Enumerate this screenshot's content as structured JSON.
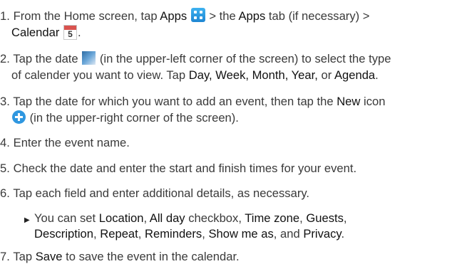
{
  "steps": [
    {
      "num": "1.",
      "a": "From the Home screen, tap ",
      "b": "Apps",
      "c": " > the ",
      "d": "Apps",
      "e": " tab (if necessary) >",
      "f": "Calendar",
      "g": ".",
      "cal_day": "5",
      "icon_apps": "apps-icon",
      "icon_calendar": "calendar-icon"
    },
    {
      "num": "2.",
      "a": "Tap the date ",
      "b": " (in the upper-left corner of the screen) to select the type",
      "c": "of calender you want to view. Tap ",
      "d": "Day, Week, Month, Year,",
      "e": " or ",
      "f": "Agenda",
      "g": ".",
      "icon_date": "date-icon"
    },
    {
      "num": "3.",
      "a": "Tap the date for which you want to add an event, then tap the ",
      "b": "New",
      "c": " icon",
      "d": " (in the upper-right corner of the screen).",
      "icon_new": "plus-circle-icon"
    },
    {
      "num": "4.",
      "a": "Enter the event name."
    },
    {
      "num": "5.",
      "a": "Check the date and enter the start and finish times for your event."
    },
    {
      "num": "6.",
      "a": "Tap each field and enter additional details, as necessary."
    },
    {
      "num": "7.",
      "a": "Tap ",
      "b": "Save",
      "c": " to save the event in the calendar."
    }
  ],
  "bullet": {
    "marker": "▶",
    "a": "You can set ",
    "b": "Location",
    "c": ", ",
    "d": "All day",
    "e": " checkbox, ",
    "f": "Time zone",
    "g": ", ",
    "h": "Guests",
    "i": ",",
    "j": "Description",
    "k": ", ",
    "l": "Repeat",
    "m": ", ",
    "n": "Reminders",
    "o": ", ",
    "p": "Show me as",
    "q": ", and ",
    "r": "Privacy",
    "s": "."
  }
}
